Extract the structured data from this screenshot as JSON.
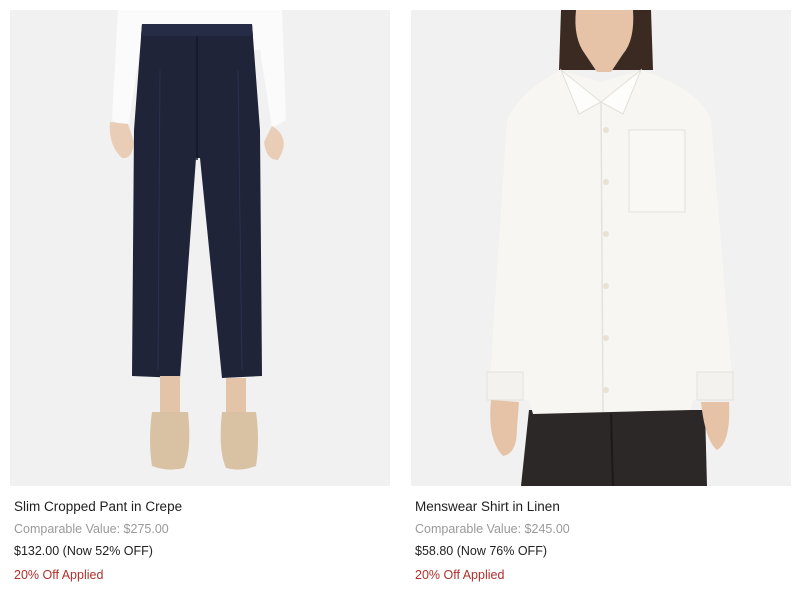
{
  "products": [
    {
      "title": "Slim Cropped Pant in Crepe",
      "comparable": "Comparable Value: $275.00",
      "price": "$132.00 (Now 52% OFF)",
      "promo": "20% Off Applied"
    },
    {
      "title": "Menswear Shirt in Linen",
      "comparable": "Comparable Value: $245.00",
      "price": "$58.80 (Now 76% OFF)",
      "promo": "20% Off Applied"
    }
  ],
  "colors": {
    "image_bg": "#f1f1f1",
    "promo": "#b0302a",
    "muted": "#9a9a9a",
    "navy_pant": "#1f2439",
    "shirt_white": "#f7f6f2"
  }
}
